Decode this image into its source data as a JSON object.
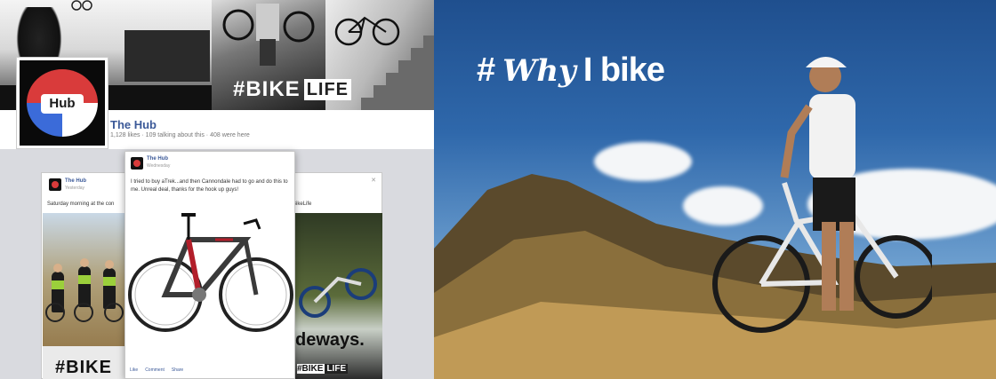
{
  "page": {
    "name": "The Hub",
    "stats": "1,128 likes · 109 talking about this · 408 were here",
    "avatar_text": "Hub"
  },
  "cover": {
    "hashtag": "#BIKE",
    "hashtag_box": "LIFE"
  },
  "post_left": {
    "name": "The Hub",
    "time": "Yesterday",
    "text_start": "Saturday morning at the con",
    "text_end": "BikeLife",
    "photo_tag": "#BIKE"
  },
  "post_front": {
    "name": "The Hub",
    "time": "Wednesday",
    "text": "I tried to buy aTrek...and then Cannondale had to go and do this to me. Unreal deal, thanks for the hook up guys!",
    "actions": [
      "Like",
      "Comment",
      "Share"
    ]
  },
  "post_right": {
    "photo_text": "deways.",
    "photo_tag": "#BIKE",
    "photo_tag_box": "LIFE"
  },
  "hero": {
    "hash": "#",
    "why": "Why",
    "words": "I bike"
  },
  "colors": {
    "facebook_blue": "#3b5998",
    "sky": "#2f68ab",
    "accent_red": "#d93b3b"
  }
}
